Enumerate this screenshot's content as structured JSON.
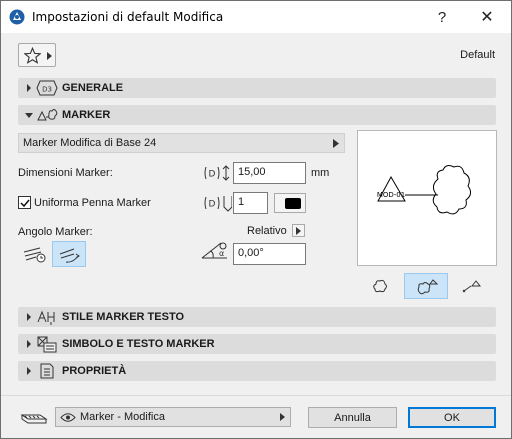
{
  "window": {
    "title": "Impostazioni di default Modifica",
    "help_label": "?",
    "close_label": "✕"
  },
  "toolbar": {
    "favorites_icon": "star-icon",
    "default_label": "Default"
  },
  "panels": {
    "generale": "GENERALE",
    "marker": "MARKER",
    "stile": "STILE MARKER TESTO",
    "simbolo": "SIMBOLO E TESTO MARKER",
    "proprieta": "PROPRIETÀ"
  },
  "marker": {
    "type_value": "Marker Modifica di Base 24",
    "size_label": "Dimensioni Marker:",
    "size_value": "15,00",
    "size_unit": "mm",
    "pen_label": "Uniforma Penna Marker",
    "pen_checked": true,
    "pen_value": "1",
    "pen_color": "#000000",
    "angle_label": "Angolo Marker:",
    "relative_label": "Relativo",
    "angle_value": "0,00°",
    "preview_text": "MOD-01"
  },
  "footer": {
    "layer_value": "Marker - Modifica",
    "cancel_label": "Annulla",
    "ok_label": "OK"
  },
  "colors": {
    "accent": "#0078d7",
    "selected_bg": "#cce4f7",
    "panel_header": "#dcdcdc"
  }
}
